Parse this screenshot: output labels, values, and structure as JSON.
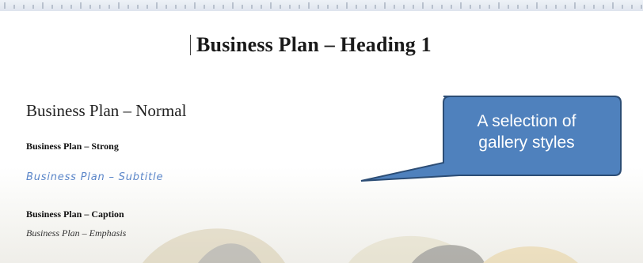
{
  "document": {
    "heading1": "Business Plan – Heading 1",
    "normal": "Business Plan – Normal",
    "strong": "Business Plan – Strong",
    "subtitle": "Business Plan – Subtitle",
    "caption": "Business Plan – Caption",
    "emphasis": "Business Plan – Emphasis"
  },
  "callout": {
    "line1": "A selection of",
    "line2": "gallery styles",
    "fill_color": "#4f81bd",
    "border_color": "#2c4d75"
  },
  "colors": {
    "subtitle": "#5b86c9",
    "ruler": "#dfe5ee"
  }
}
